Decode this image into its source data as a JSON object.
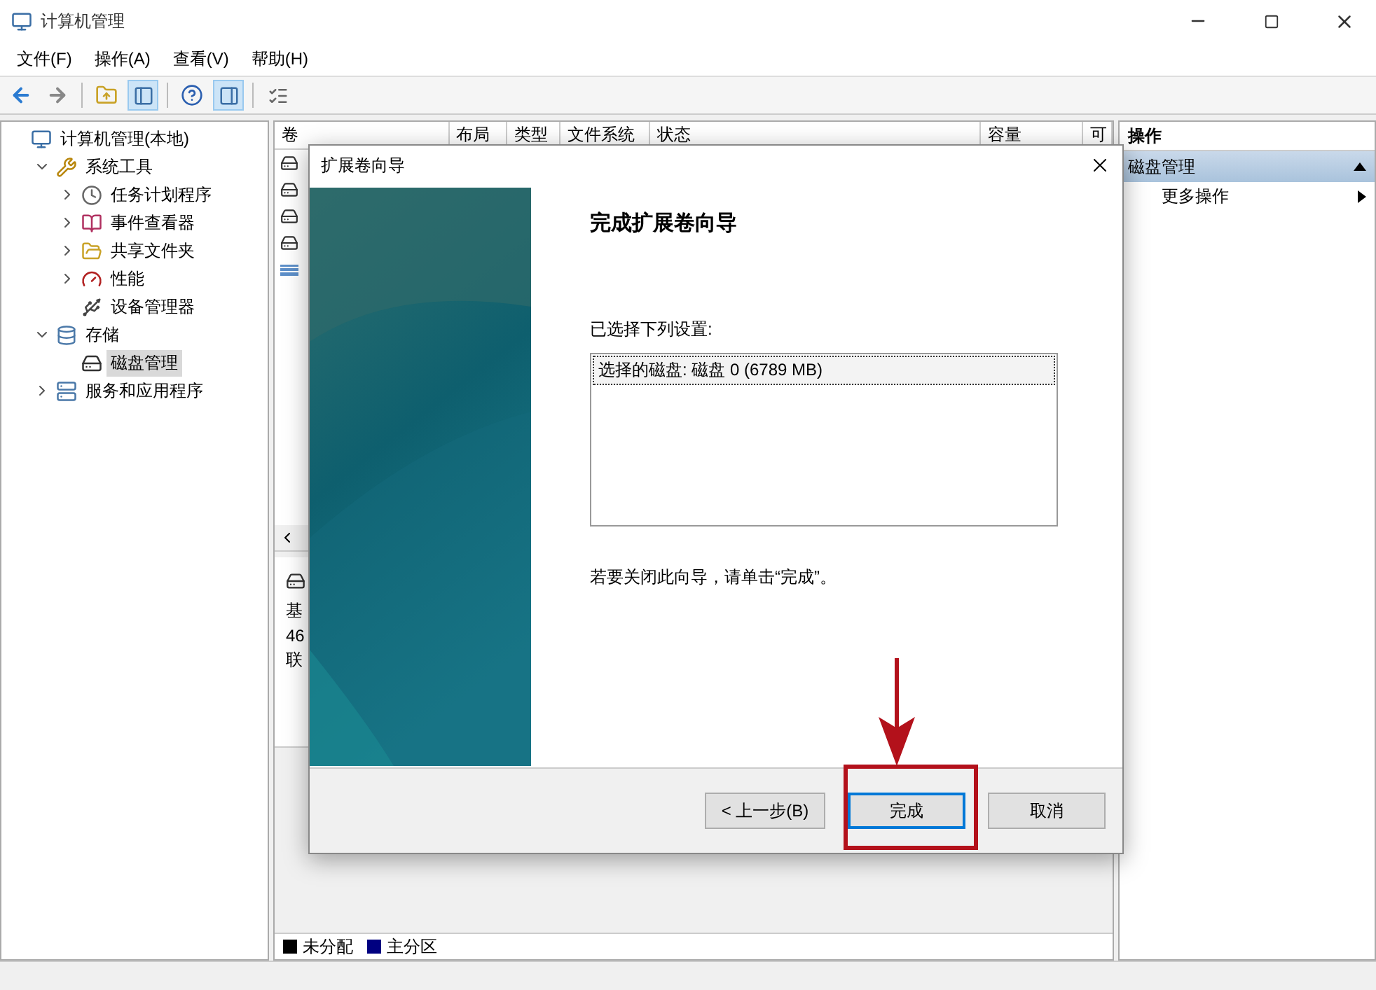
{
  "window": {
    "title": "计算机管理"
  },
  "menu": [
    "文件(F)",
    "操作(A)",
    "查看(V)",
    "帮助(H)"
  ],
  "tree": [
    {
      "label": "计算机管理(本地)",
      "selected": false,
      "children": [
        {
          "label": "系统工具",
          "expanded": true,
          "selected": false,
          "children": [
            {
              "label": "任务计划程序",
              "expanded": false,
              "selected": false
            },
            {
              "label": "事件查看器",
              "expanded": false,
              "selected": false
            },
            {
              "label": "共享文件夹",
              "expanded": false,
              "selected": false
            },
            {
              "label": "性能",
              "expanded": false,
              "selected": false
            },
            {
              "label": "设备管理器",
              "selected": false
            }
          ]
        },
        {
          "label": "存储",
          "expanded": true,
          "selected": false,
          "children": [
            {
              "label": "磁盘管理",
              "selected": true
            }
          ]
        },
        {
          "label": "服务和应用程序",
          "expanded": false,
          "selected": false
        }
      ]
    }
  ],
  "volumes": {
    "columns": [
      "卷",
      "布局",
      "类型",
      "文件系统",
      "状态",
      "容量",
      "可"
    ],
    "rows": [
      {
        "kind": "disk"
      },
      {
        "kind": "disk"
      },
      {
        "kind": "disk"
      },
      {
        "kind": "disk"
      },
      {
        "kind": "striped"
      }
    ]
  },
  "disk_info": [
    "基",
    "46",
    "联"
  ],
  "legend": [
    {
      "label": "未分配",
      "color": "#000000"
    },
    {
      "label": "主分区",
      "color": "#000080"
    }
  ],
  "actions": {
    "title": "操作",
    "section": {
      "label": "磁盘管理",
      "expanded": true
    },
    "items": [
      "更多操作"
    ]
  },
  "dialog": {
    "title": "扩展卷向导",
    "heading": "完成扩展卷向导",
    "settings_label": "已选择下列设置:",
    "settings": [
      {
        "text": "选择的磁盘: 磁盘 0 (6789 MB)",
        "selected": true
      }
    ],
    "closing_note": "若要关闭此向导，请单击“完成”。",
    "buttons": [
      {
        "label": "< 上一步(B)",
        "focused": false,
        "highlighted": false
      },
      {
        "label": "完成",
        "focused": true,
        "highlighted": true
      },
      {
        "label": "取消",
        "focused": false,
        "highlighted": false
      }
    ]
  }
}
